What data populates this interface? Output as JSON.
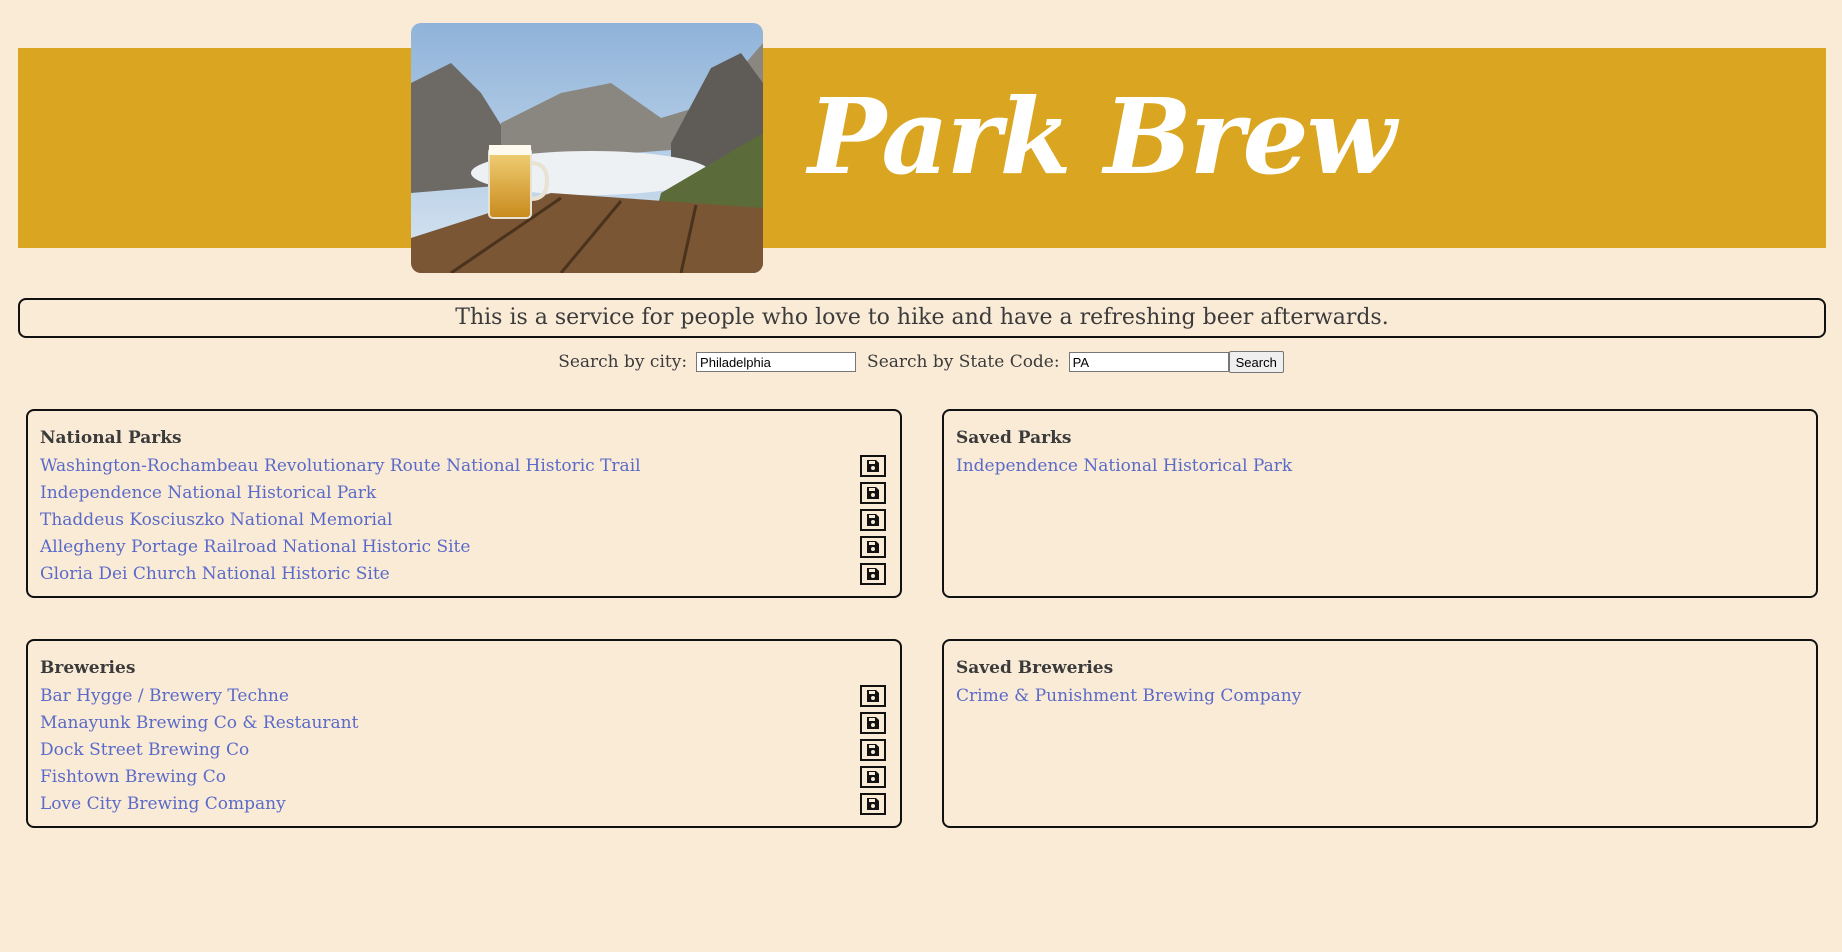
{
  "header": {
    "title": "Park Brew",
    "hero_image": "mountain-beer-photo"
  },
  "tagline": "This is a service for people who love to hike and have a refreshing beer afterwards.",
  "search": {
    "city_label": "Search by city:",
    "city_value": "Philadelphia",
    "state_label": "Search by State Code:",
    "state_value": "PA",
    "button_label": "Search"
  },
  "national_parks": {
    "heading": "National Parks",
    "items": [
      {
        "name": "Washington-Rochambeau Revolutionary Route National Historic Trail"
      },
      {
        "name": "Independence National Historical Park"
      },
      {
        "name": "Thaddeus Kosciuszko National Memorial"
      },
      {
        "name": "Allegheny Portage Railroad National Historic Site"
      },
      {
        "name": "Gloria Dei Church National Historic Site"
      }
    ]
  },
  "saved_parks": {
    "heading": "Saved Parks",
    "items": [
      {
        "name": "Independence National Historical Park"
      }
    ]
  },
  "breweries": {
    "heading": "Breweries",
    "items": [
      {
        "name": "Bar Hygge / Brewery Techne"
      },
      {
        "name": "Manayunk Brewing Co & Restaurant"
      },
      {
        "name": "Dock Street Brewing Co"
      },
      {
        "name": "Fishtown Brewing Co"
      },
      {
        "name": "Love City Brewing Company"
      }
    ]
  },
  "saved_breweries": {
    "heading": "Saved Breweries",
    "items": [
      {
        "name": "Crime & Punishment Brewing Company"
      }
    ]
  },
  "colors": {
    "background": "#faebd7",
    "banner": "#daa520",
    "link": "#5a6ac8"
  },
  "icons": {
    "save": "floppy-disk-icon"
  }
}
